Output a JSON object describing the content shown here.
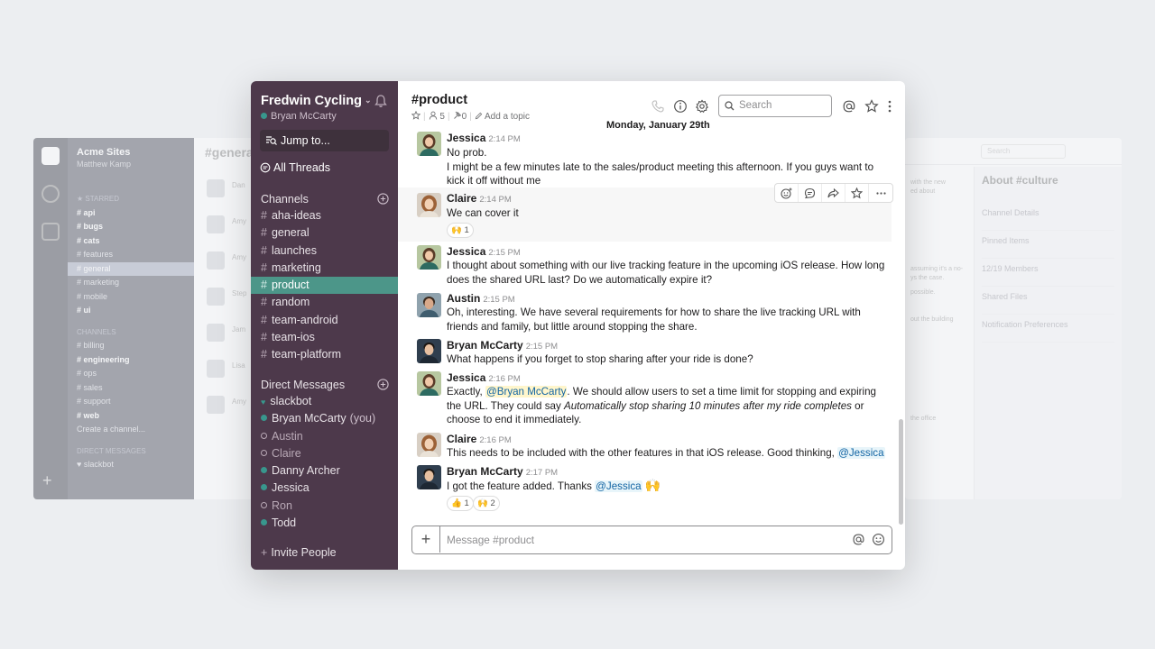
{
  "bg_left": {
    "workspace": "Acme Sites",
    "user": "Matthew Kamp",
    "lines": [
      {
        "t": "★ STARRED",
        "c": "hd"
      },
      {
        "t": "# api",
        "c": "b"
      },
      {
        "t": "# bugs",
        "c": "b"
      },
      {
        "t": "# cats",
        "c": "b"
      },
      {
        "t": "# features",
        "c": ""
      },
      {
        "t": "# general",
        "c": "sel"
      },
      {
        "t": "# marketing",
        "c": ""
      },
      {
        "t": "# mobile",
        "c": ""
      },
      {
        "t": "# ui",
        "c": "b"
      },
      {
        "t": "CHANNELS",
        "c": "hd"
      },
      {
        "t": "# billing",
        "c": ""
      },
      {
        "t": "# engineering",
        "c": "b"
      },
      {
        "t": "# ops",
        "c": ""
      },
      {
        "t": "# sales",
        "c": ""
      },
      {
        "t": "# support",
        "c": ""
      },
      {
        "t": "# web",
        "c": "b"
      },
      {
        "t": "Create a channel...",
        "c": ""
      },
      {
        "t": "DIRECT MESSAGES",
        "c": "hd"
      },
      {
        "t": "♥ slackbot",
        "c": ""
      }
    ],
    "main_title": "#genera",
    "names": [
      "Dan",
      "Amy",
      "Amy",
      "Step",
      "Jam",
      "Lisa",
      "Amy"
    ]
  },
  "bg_right": {
    "search": "Search",
    "about_title": "About #culture",
    "rows": [
      "Channel Details",
      "Pinned Items",
      "12/19 Members",
      "Shared Files",
      "Notification Preferences"
    ],
    "snippets": [
      "with the new",
      "ed about",
      "assuming it's a no-",
      "ys the case.",
      "possible.",
      "out the building",
      "the office"
    ]
  },
  "sidebar": {
    "team_name": "Fredwin Cycling",
    "user_name": "Bryan McCarty",
    "jump_label": "Jump to...",
    "threads_label": "All Threads",
    "channels_header": "Channels",
    "channels": [
      "aha-ideas",
      "general",
      "launches",
      "marketing",
      "product",
      "random",
      "team-android",
      "team-ios",
      "team-platform"
    ],
    "active_channel": "product",
    "dm_header": "Direct Messages",
    "dms": [
      {
        "name": "slackbot",
        "status": "heart",
        "you": ""
      },
      {
        "name": "Bryan McCarty",
        "status": "on",
        "you": "(you)"
      },
      {
        "name": "Austin",
        "status": "off",
        "you": ""
      },
      {
        "name": "Claire",
        "status": "off",
        "you": ""
      },
      {
        "name": "Danny Archer",
        "status": "on",
        "you": ""
      },
      {
        "name": "Jessica",
        "status": "on",
        "you": ""
      },
      {
        "name": "Ron",
        "status": "off",
        "you": ""
      },
      {
        "name": "Todd",
        "status": "on",
        "you": ""
      }
    ],
    "invite_label": "Invite People"
  },
  "header": {
    "channel": "#product",
    "members": "5",
    "pins": "0",
    "add_topic": "Add a topic",
    "search_placeholder": "Search"
  },
  "date_divider": "Monday, January 29th",
  "messages": [
    {
      "author": "Jessica",
      "time": "2:14 PM",
      "lines": [
        "No prob.",
        "I might be a few minutes late to the sales/product meeting this afternoon. If you guys want to kick it off without me"
      ]
    },
    {
      "author": "Claire",
      "time": "2:14 PM",
      "text": "We can cover it",
      "reaction": "🙌 1"
    },
    {
      "author": "Jessica",
      "time": "2:15 PM",
      "text": "I thought about something with our live tracking feature in the upcoming iOS release. How long does the shared URL last? Do we automatically expire it?"
    },
    {
      "author": "Austin",
      "time": "2:15 PM",
      "text": "Oh, interesting. We have several requirements for how to share the live tracking URL with friends and family, but little around stopping the share."
    },
    {
      "author": "Bryan McCarty",
      "time": "2:15 PM",
      "text": "What happens if you forget to stop sharing after your ride is done?"
    },
    {
      "author": "Jessica",
      "time": "2:16 PM",
      "pre": "Exactly, ",
      "mention": "@Bryan McCarty",
      "mid": ". We should allow users to set a time limit for stopping and expiring the URL. They could say ",
      "italic": "Automatically stop sharing 10 minutes after my ride completes",
      "post": " or choose to end it immediately."
    },
    {
      "author": "Claire",
      "time": "2:16 PM",
      "pre": "This needs to be included with the other features in that iOS release. Good thinking, ",
      "mention": "@Jessica"
    },
    {
      "author": "Bryan McCarty",
      "time": "2:17 PM",
      "pre": "I got the feature added. Thanks ",
      "mention": "@Jessica",
      "emoji": "🙌",
      "reactions": [
        "👍 1",
        "🙌 2"
      ]
    }
  ],
  "composer": {
    "placeholder": "Message #product"
  },
  "colors": {
    "sidebar_bg": "#4d394b",
    "active_channel": "#4c9689",
    "presence": "#38978d",
    "link": "#1264a3"
  }
}
